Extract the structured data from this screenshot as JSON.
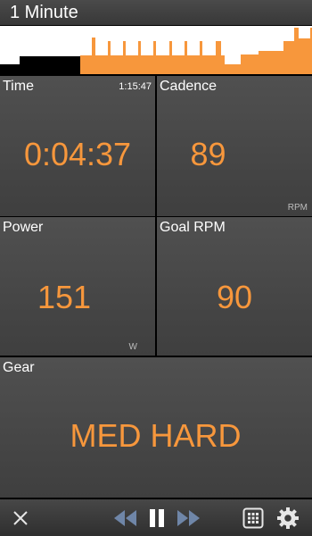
{
  "header": {
    "title": "1 Minute"
  },
  "profile_icon": "interval-profile-chart",
  "tiles": {
    "time": {
      "label": "Time",
      "clock": "1:15:47",
      "value": "0:04:37"
    },
    "cadence": {
      "label": "Cadence",
      "value": "89",
      "unit": "RPM"
    },
    "power": {
      "label": "Power",
      "value": "151",
      "unit": "W"
    },
    "goal_rpm": {
      "label": "Goal RPM",
      "value": "90"
    },
    "gear": {
      "label": "Gear",
      "value": "MED HARD"
    }
  },
  "toolbar": {
    "close_icon": "close-icon",
    "rewind_icon": "rewind-icon",
    "pause_icon": "pause-icon",
    "forward_icon": "fast-forward-icon",
    "grid_icon": "grid-icon",
    "settings_icon": "gear-icon"
  },
  "colors": {
    "accent": "#f7973c",
    "completed": "#000000",
    "background": "#000000",
    "tile": "#474747"
  }
}
